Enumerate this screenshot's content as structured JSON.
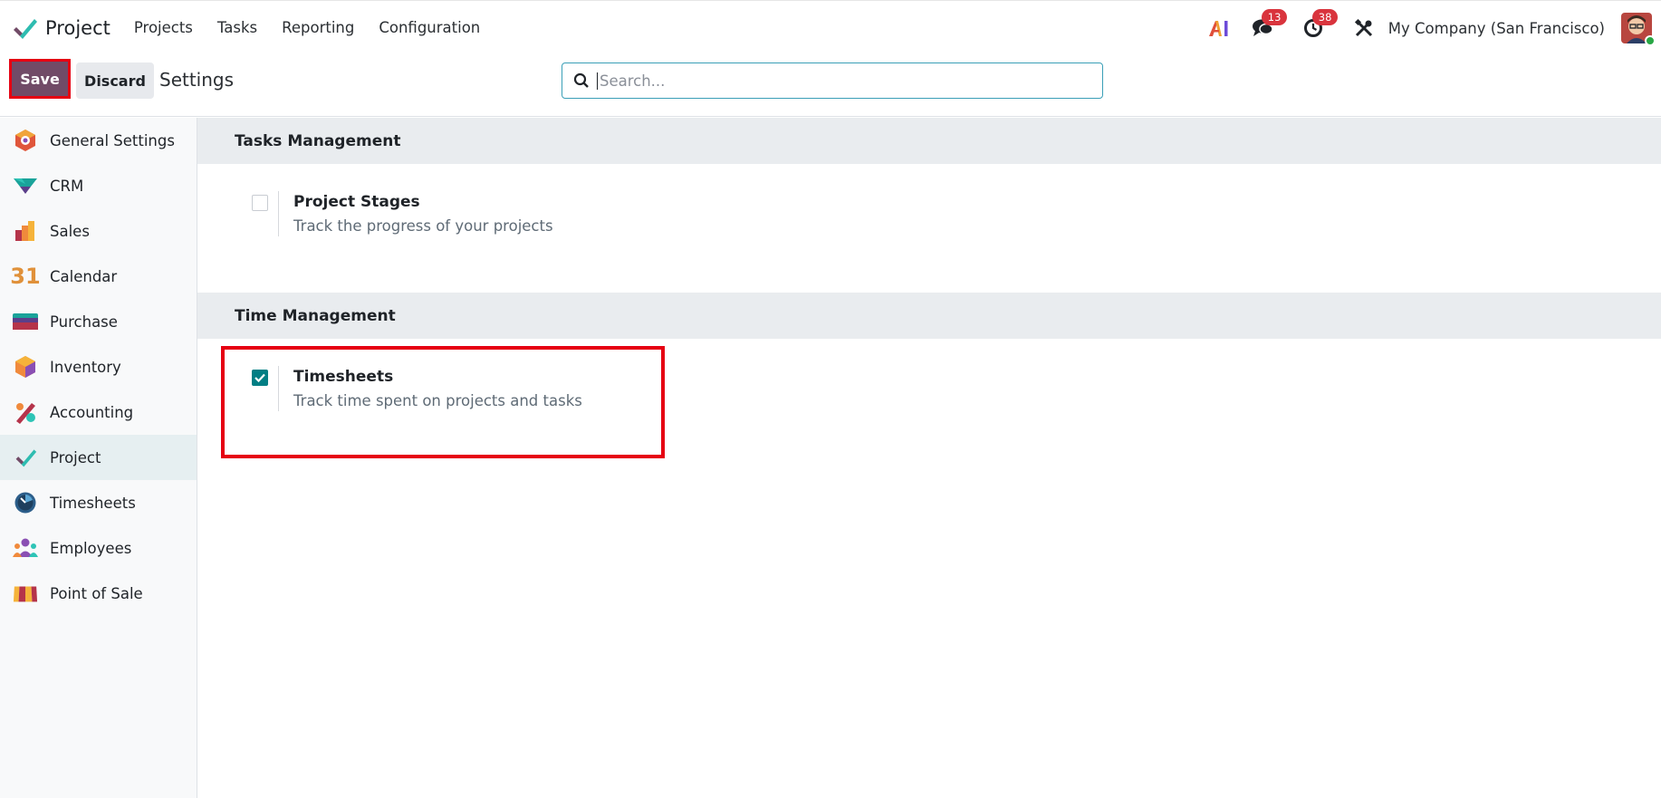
{
  "navbar": {
    "app_name": "Project",
    "menu": [
      "Projects",
      "Tasks",
      "Reporting",
      "Configuration"
    ],
    "messages_badge": "13",
    "activities_badge": "38",
    "company": "My Company (San Francisco)"
  },
  "control": {
    "save_label": "Save",
    "discard_label": "Discard",
    "title": "Settings",
    "search_placeholder": "Search...",
    "search_value": ""
  },
  "sidebar": {
    "items": [
      {
        "label": "General Settings",
        "icon": "general-settings-icon"
      },
      {
        "label": "CRM",
        "icon": "crm-icon"
      },
      {
        "label": "Sales",
        "icon": "sales-icon"
      },
      {
        "label": "Calendar",
        "icon": "calendar-icon"
      },
      {
        "label": "Purchase",
        "icon": "purchase-icon"
      },
      {
        "label": "Inventory",
        "icon": "inventory-icon"
      },
      {
        "label": "Accounting",
        "icon": "accounting-icon"
      },
      {
        "label": "Project",
        "icon": "project-icon",
        "active": true
      },
      {
        "label": "Timesheets",
        "icon": "timesheets-icon"
      },
      {
        "label": "Employees",
        "icon": "employees-icon"
      },
      {
        "label": "Point of Sale",
        "icon": "point-of-sale-icon"
      }
    ]
  },
  "sections": [
    {
      "title": "Tasks Management",
      "settings": [
        {
          "title": "Project Stages",
          "description": "Track the progress of your projects",
          "checked": false
        }
      ]
    },
    {
      "title": "Time Management",
      "settings": [
        {
          "title": "Timesheets",
          "description": "Track time spent on projects and tasks",
          "checked": true
        }
      ]
    }
  ],
  "calendar_icon_text": "31",
  "colors": {
    "brand": "#714b67",
    "accent": "#017e84",
    "highlight": "#e60012",
    "badge": "#d9343d"
  }
}
